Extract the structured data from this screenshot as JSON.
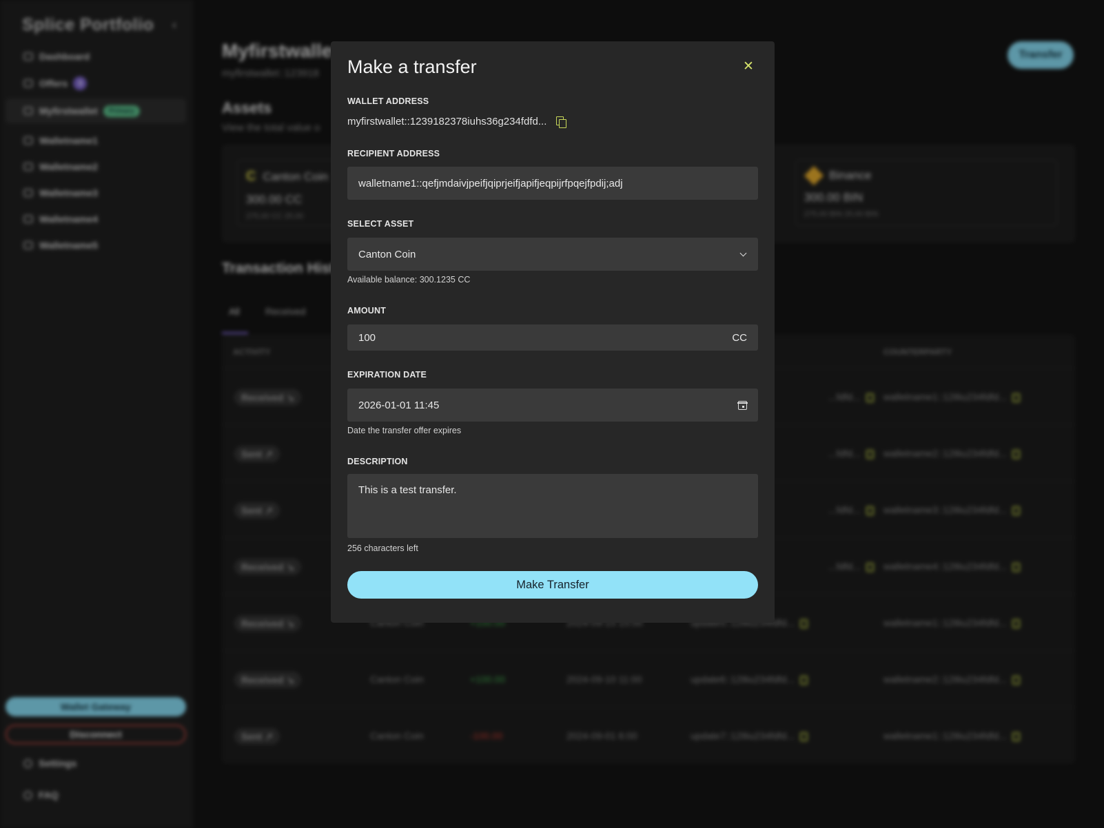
{
  "app": {
    "logo": "Splice Portfolio",
    "collapse_icon": "‹",
    "nav": [
      {
        "label": "Dashboard"
      },
      {
        "label": "Offers",
        "count": "3"
      },
      {
        "label": "Myfirstwallet",
        "badge": "Primary"
      },
      {
        "label": "Walletname1"
      },
      {
        "label": "Walletname2"
      },
      {
        "label": "Walletname3"
      },
      {
        "label": "Walletname4"
      },
      {
        "label": "Walletname5"
      }
    ],
    "gateway_label": "Wallet Gateway",
    "disconnect_label": "Disconnect",
    "settings_label": "Settings",
    "faq_label": "FAQ"
  },
  "wallet": {
    "title": "Myfirstwallet",
    "address": "myfirstwallet::123918",
    "transfer_label": "Transfer"
  },
  "assets": {
    "heading": "Assets",
    "subtitle": "View the total value o",
    "cards": [
      {
        "name": "Canton Coin",
        "amount": "300.00 CC",
        "detail": "275.00 CC   25.00"
      },
      {
        "name": "Binance",
        "amount": "300.00 BIN",
        "detail": "275.00 BIN   25.00 BIN"
      }
    ]
  },
  "transactions": {
    "heading": "Transaction Hist",
    "tabs": [
      "All",
      "Received"
    ],
    "columns": {
      "activity": "ACTIVITY",
      "counterparty": "COUNTERPARTY"
    },
    "rows": [
      {
        "activity": "Received ↘",
        "asset": "",
        "amount": "",
        "date": "",
        "update": "...fdfd...",
        "counterparty": "walletname1::128iu234fdfd..."
      },
      {
        "activity": "Sent ↗",
        "asset": "",
        "amount": "",
        "date": "",
        "update": "...fdfd...",
        "counterparty": "walletname2::128iu234fdfd..."
      },
      {
        "activity": "Sent ↗",
        "asset": "",
        "amount": "",
        "date": "",
        "update": "...fdfd...",
        "counterparty": "walletname3::128iu234fdfd..."
      },
      {
        "activity": "Received ↘",
        "asset": "",
        "amount": "",
        "date": "",
        "update": "...fdfd...",
        "counterparty": "walletname4::128iu234fdfd..."
      },
      {
        "activity": "Received ↘",
        "asset": "Canton Coin",
        "amount": "+100.00",
        "date": "2024-09-15 15:00",
        "update": "update5::128iu234fdfd...",
        "counterparty": "walletname1::128iu234fdfd..."
      },
      {
        "activity": "Received ↘",
        "asset": "Canton Coin",
        "amount": "+100.00",
        "date": "2024-09-10 11:00",
        "update": "update6::128iu234fdfd...",
        "counterparty": "walletname2::128iu234fdfd..."
      },
      {
        "activity": "Sent ↗",
        "asset": "Canton Coin",
        "amount": "-100.00",
        "date": "2024-09-01 6:00",
        "update": "update7::128iu234fdfd...",
        "counterparty": "walletname1::128iu234fdfd..."
      }
    ]
  },
  "modal": {
    "title": "Make a transfer",
    "close_icon": "✕",
    "wallet_address_label": "WALLET ADDRESS",
    "wallet_address": "myfirstwallet::1239182378iuhs36g234fdfd...",
    "recipient_label": "RECIPIENT ADDRESS",
    "recipient_value": "walletname1::qefjmdaivjpeifjqiprjeifjapifjeqpijrfpqejfpdij;adj",
    "asset_label": "SELECT ASSET",
    "asset_value": "Canton Coin",
    "available_balance": "Available balance: 300.1235 CC",
    "amount_label": "AMOUNT",
    "amount_value": "100",
    "amount_unit": "CC",
    "expiration_label": "EXPIRATION DATE",
    "expiration_value": "2026-01-01 11:45",
    "expiration_help": "Date the transfer offer expires",
    "description_label": "DESCRIPTION",
    "description_value": "This is a test transfer.",
    "chars_left": "256 characters left",
    "submit_label": "Make Transfer"
  },
  "colors": {
    "accent": "#92e2f8",
    "icon_accent": "#c9d95a",
    "positive": "#3ea64a",
    "negative": "#c23a2f",
    "primary_badge": "#5bbf8a",
    "offers_badge": "#7a62c9"
  }
}
